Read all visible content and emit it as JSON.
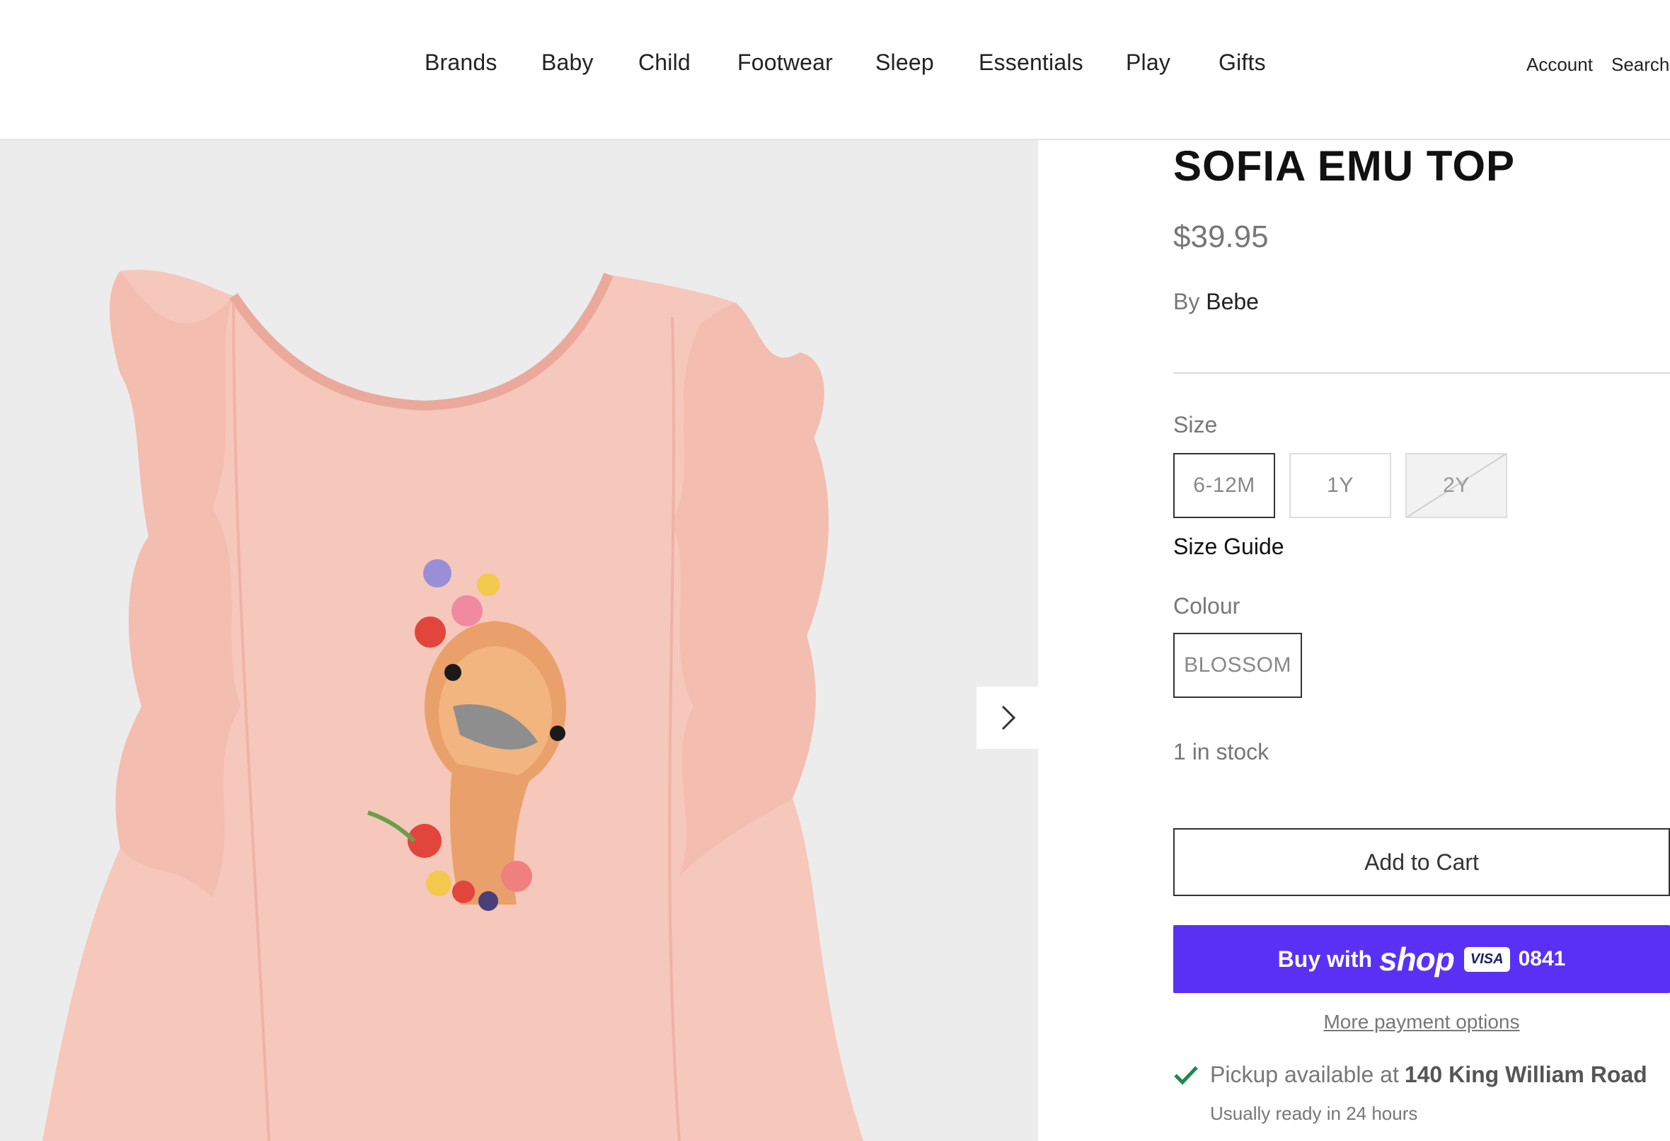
{
  "nav": {
    "items": [
      {
        "label": "Brands"
      },
      {
        "label": "Baby"
      },
      {
        "label": "Child"
      },
      {
        "label": "Footwear"
      },
      {
        "label": "Sleep"
      },
      {
        "label": "Essentials"
      },
      {
        "label": "Play"
      },
      {
        "label": "Gifts"
      }
    ],
    "account_label": "Account",
    "search_label": "Search"
  },
  "gallery": {
    "image_icon": "product-photo-pink-ruffle-top-with-emu-print",
    "next_icon": "chevron-right-icon"
  },
  "product": {
    "title": "SOFIA EMU TOP",
    "price": "$39.95",
    "vendor_prefix": "By",
    "vendor": "Bebe",
    "size_label": "Size",
    "sizes": [
      {
        "label": "6-12M",
        "state": "selected"
      },
      {
        "label": "1Y",
        "state": "available"
      },
      {
        "label": "2Y",
        "state": "sold-out"
      }
    ],
    "size_guide": "Size Guide",
    "colour_label": "Colour",
    "colours": [
      {
        "label": "BLOSSOM",
        "state": "selected"
      }
    ],
    "stock": "1 in stock",
    "add_to_cart": "Add to Cart",
    "shop_pay": {
      "buy_with": "Buy with",
      "brand": "shop",
      "card": "VISA",
      "last_digits": "0841",
      "color": "#5a31f4"
    },
    "more_payment": "More payment options",
    "pickup": {
      "text": "Pickup available at",
      "location": "140 King William Road",
      "ready": "Usually ready in 24 hours",
      "check_color": "#1d8a4a"
    }
  }
}
